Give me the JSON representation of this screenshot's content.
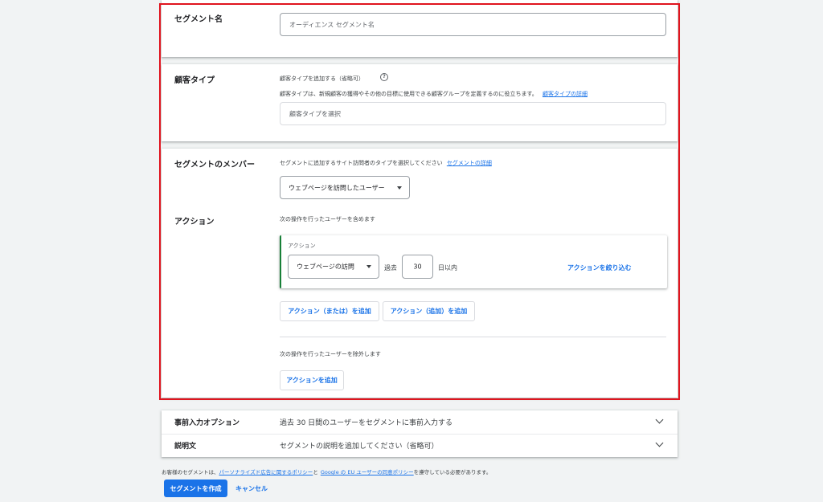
{
  "segment_name": {
    "label": "セグメント名",
    "placeholder": "オーディエンス セグメント名"
  },
  "customer_type": {
    "label": "顧客タイプ",
    "hint": "顧客タイプを追加する（省略可）",
    "help_icon": "help-circle-icon",
    "description": "顧客タイプは、新規顧客の獲得やその他の目標に使用できる顧客グループを定義するのに役立ちます。",
    "details_link": "顧客タイプの詳細",
    "placeholder": "顧客タイプを選択"
  },
  "members": {
    "label": "セグメントのメンバー",
    "description": "セグメントに追加するサイト訪問者のタイプを選択してください",
    "details_link": "セグメントの詳細",
    "select_value": "ウェブページを訪問したユーザー"
  },
  "actions": {
    "label": "アクション",
    "include_text": "次の操作を行ったユーザーを含めます",
    "card_title": "アクション",
    "action_select": "ウェブページの訪問",
    "past_label": "過去",
    "days_value": "30",
    "days_suffix": "日以内",
    "refine_button": "アクションを絞り込む",
    "add_or_button": "アクション（または）を追加",
    "add_and_button": "アクション（追加）を追加",
    "exclude_text": "次の操作を行ったユーザーを除外します",
    "add_exclude_button": "アクションを追加"
  },
  "prefill": {
    "label": "事前入力オプション",
    "value": "過去 30 日間のユーザーをセグメントに事前入力する"
  },
  "desc_row": {
    "label": "説明文",
    "value": "セグメントの説明を追加してください（省略可）"
  },
  "footer": {
    "policy_prefix": "お客様のセグメントは、",
    "policy_link1": "パーソナライズド広告に関するポリシー",
    "policy_mid": "と",
    "policy_link2": "Google の EU ユーザーの同意ポリシー",
    "policy_suffix": "を遵守している必要があります。",
    "create_button": "セグメントを作成",
    "cancel_button": "キャンセル"
  },
  "colors": {
    "accent": "#1a73e8",
    "highlight_border": "#e0141e",
    "action_card_border": "#188038"
  }
}
